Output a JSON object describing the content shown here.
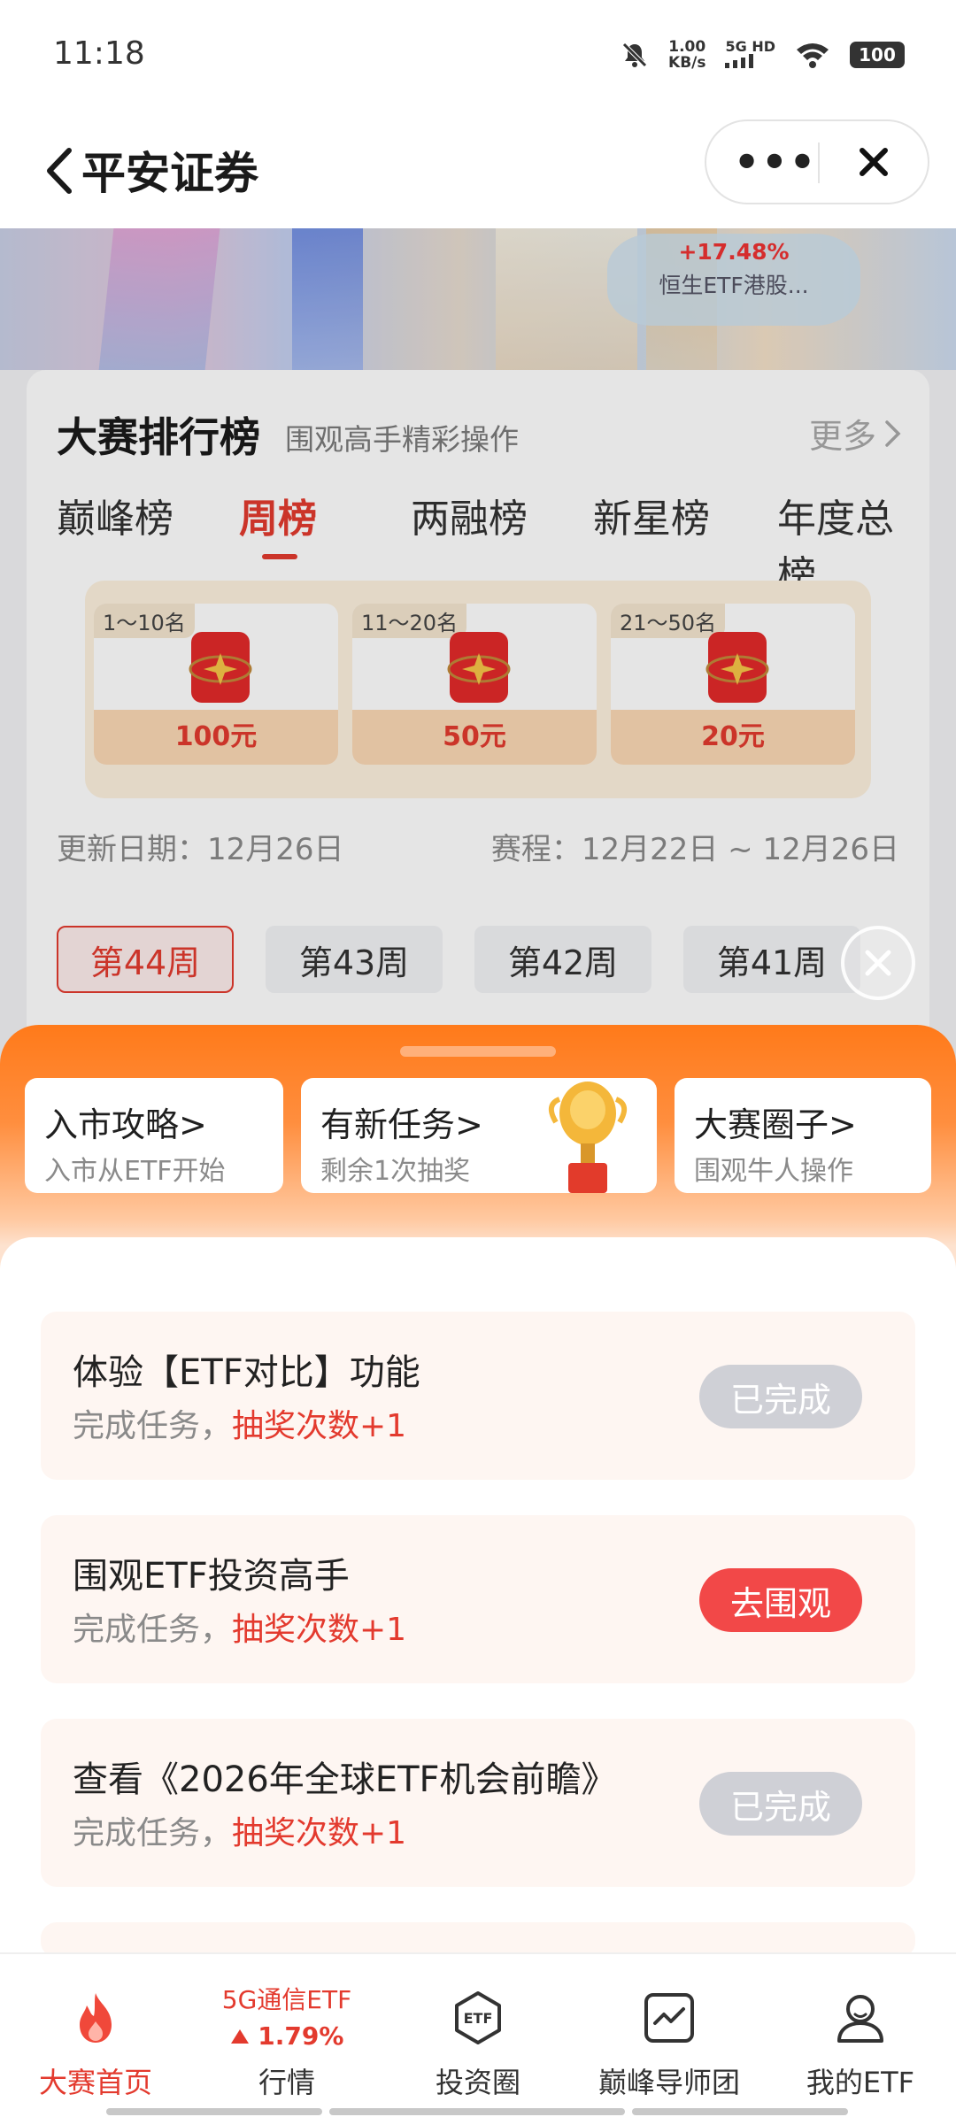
{
  "status_bar": {
    "time": "11:18",
    "speed_value": "1.00",
    "speed_unit": "KB/s",
    "network": "5G HD",
    "battery": "100"
  },
  "navbar": {
    "title": "平安证券",
    "more_label": "•••"
  },
  "banner": {
    "change": "+17.48%",
    "fund_name": "恒生ETF港股..."
  },
  "leaderboard": {
    "title": "大赛排行榜",
    "subtitle": "围观高手精彩操作",
    "more": "更多",
    "tabs": [
      "巅峰榜",
      "周榜",
      "两融榜",
      "新星榜",
      "年度总榜"
    ],
    "active_tab": "周榜",
    "prizes": [
      {
        "rank": "1～10名",
        "amount": "100元"
      },
      {
        "rank": "11～20名",
        "amount": "50元"
      },
      {
        "rank": "21～50名",
        "amount": "20元"
      }
    ],
    "update_date": "更新日期：12月26日",
    "schedule": "赛程：12月22日 ~ 12月26日",
    "weeks": [
      "第44周",
      "第43周",
      "第42周",
      "第41周"
    ],
    "active_week": "第44周"
  },
  "quick_entries": [
    {
      "title": "入市攻略>",
      "sub": "入市从ETF开始"
    },
    {
      "title": "有新任务>",
      "sub": "剩余1次抽奖"
    },
    {
      "title": "大赛圈子>",
      "sub": "围观牛人操作"
    }
  ],
  "tasks": [
    {
      "title": "体验【ETF对比】功能",
      "sub_prefix": "完成任务，",
      "reward": "抽奖次数+1",
      "button": "已完成",
      "state": "done"
    },
    {
      "title": "围观ETF投资高手",
      "sub_prefix": "完成任务，",
      "reward": "抽奖次数+1",
      "button": "去围观",
      "state": "go"
    },
    {
      "title": "查看《2026年全球ETF机会前瞻》",
      "sub_prefix": "完成任务，",
      "reward": "抽奖次数+1",
      "button": "已完成",
      "state": "done"
    }
  ],
  "tab_bar": {
    "items": [
      {
        "label": "大赛首页",
        "icon": "flame-icon",
        "active": true
      },
      {
        "label": "行情",
        "icon": "quote-ticker"
      },
      {
        "label": "投资圈",
        "icon": "etf-hexagon-icon"
      },
      {
        "label": "巅峰导师团",
        "icon": "chart-line-icon"
      },
      {
        "label": "我的ETF",
        "icon": "user-icon"
      }
    ],
    "quote": {
      "name": "5G通信ETF",
      "change": "1.79%",
      "direction": "up"
    }
  },
  "colors": {
    "accent_red": "#e33a2e",
    "sheet_orange": "#ff7a1a",
    "done_gray": "#cfd0d6",
    "go_red": "#f24848"
  }
}
